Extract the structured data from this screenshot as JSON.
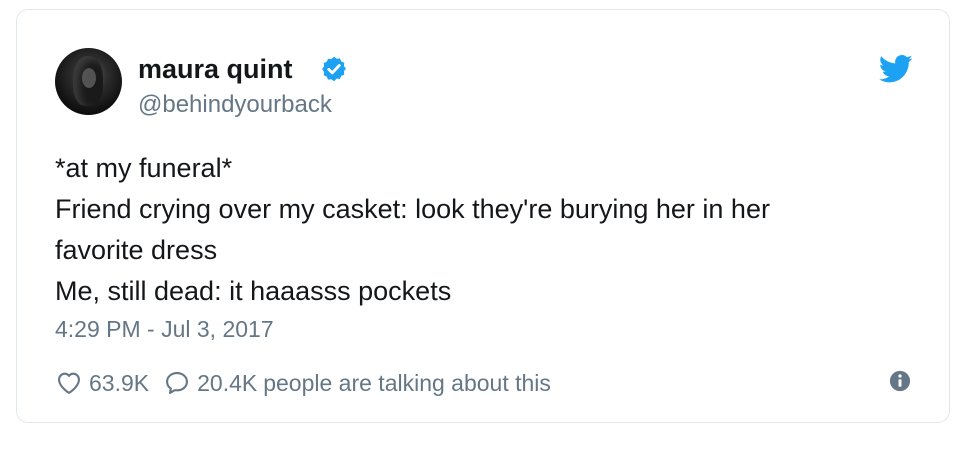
{
  "author": {
    "display_name": "maura quint",
    "handle": "@behindyourback",
    "verified": true
  },
  "tweet": {
    "lines": [
      "*at my funeral*",
      "Friend crying over my casket: look they're burying her in her",
      "favorite dress",
      "Me, still dead: it haaasss pockets"
    ],
    "timestamp": "4:29 PM - Jul 3, 2017"
  },
  "stats": {
    "likes": "63.9K",
    "replies": "20.4K",
    "talking_suffix": "people are talking about this"
  },
  "icons": {
    "verified": "verified-badge-icon",
    "brand": "twitter-bird-icon",
    "like": "heart-icon",
    "reply": "speech-bubble-icon",
    "info": "info-icon"
  },
  "colors": {
    "brand_blue": "#1da1f2",
    "text_primary": "#14171a",
    "text_secondary": "#657786",
    "border": "#e1e8ed"
  }
}
